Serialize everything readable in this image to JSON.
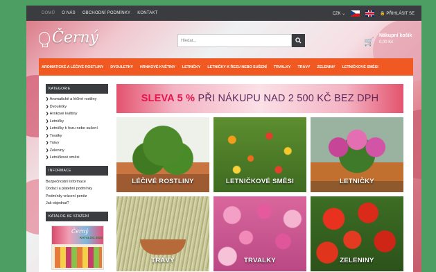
{
  "topbar": {
    "nav": [
      "DOMŮ",
      "O NÁS",
      "OBCHODNÍ PODMÍNKY",
      "KONTAKT"
    ],
    "currency": "CZK",
    "login": "PŘIHLÁSIT SE"
  },
  "header": {
    "logo": "Černý",
    "search_placeholder": "Hledat...",
    "cart_title": "Nákupní košík",
    "cart_amount": "0,00 Kč"
  },
  "catnav": [
    "AROMATICKÉ A LÉČIVÉ ROSTLINY",
    "DVOULETKY",
    "HRNKOVÉ KVĚTINY",
    "LETNIČKY",
    "LETNIČKY K ŘEZU NEBO SUŠENÍ",
    "TRVALKY",
    "TRÁVY",
    "ZELENINY",
    "LETNIČKOVÉ SMĚSI"
  ],
  "sidebar": {
    "categories_title": "KATEGORIE",
    "categories": [
      "Aromatické a léčivé rostliny",
      "Dvouletky",
      "Hrnkové květiny",
      "Letničky",
      "Letničky k řezu nebo sušení",
      "Trvalky",
      "Trávy",
      "Zeleniny",
      "Letničkové směsi"
    ],
    "info_title": "INFORMACE",
    "info": [
      "Bezpečnostní informace",
      "Dodací a platební podmínky",
      "Podmínky vrácení peněz",
      "Jak objednat?"
    ],
    "catalog_title": "KATALOG KE STAŽENÍ",
    "catalog_logo": "Černý",
    "catalog_cover": "KATALOG 2024"
  },
  "banner": {
    "discount": "SLEVA 5 %",
    "rest": " PŘI NÁKUPU NAD 2 500 KČ BEZ DPH"
  },
  "tiles": [
    "LÉČIVÉ ROSTLINY",
    "LETNIČKOVÉ SMĚSI",
    "LETNIČKY",
    "TRÁVY",
    "TRVALKY",
    "ZELENINY"
  ]
}
